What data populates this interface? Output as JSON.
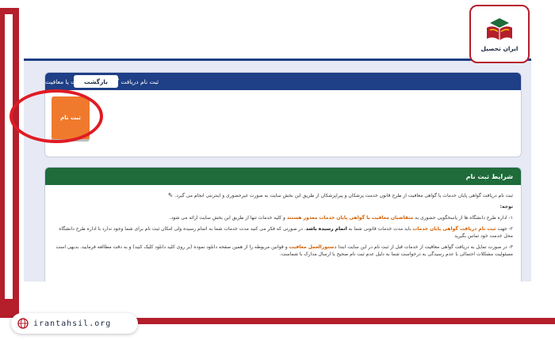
{
  "brand": {
    "logo_text": "ایران تحصیل",
    "site_url": "irantahsil.org",
    "accent_color": "#b51e2b"
  },
  "panel_register": {
    "title": "ثبت نام دریافت گواهی پایان خدمات یا معافیت",
    "back_label": "بازگشت",
    "tile_label": "ثبت نام",
    "header_color": "#1f3f86",
    "tile_color": "#ef7a2d",
    "highlight_color": "#e01b24"
  },
  "panel_conditions": {
    "title": "شرایط ثبت نام",
    "header_color": "#1f6b3a",
    "intro": "ثبت نام دریافت گواهی پایان خدمات یا گواهی معافیت از طرح قانون خدمت پزشکان و پیراپزشکان از طریق این بخش سایت به صورت غیرحضوری و اینترنتی انجام می گیرد.",
    "note_label": "توجه:",
    "item1_prefix": "۱- اداره طرح دانشگاه ها از پاسخگویی حضوری به ",
    "item1_link": "متقاضیان معافیت یا گواهی پایان خدمات معذور هستند",
    "item1_suffix": " و کلیه خدمات تنها از طریق این بخش سایت ارائه می شود.",
    "item2_prefix": "۲- جهت ",
    "item2_link": "ثبت نام دریافت گواهی پایان خدمات",
    "item2_middle": " باید مدت خدمات قانونی شما به ",
    "item2_bold": "اتمام رسیده باشد",
    "item2_suffix": ". در صورتی که فکر می کنید مدت خدمات شما به اتمام رسیده ولی امکان ثبت نام برای شما وجود ندارد با اداره طرح دانشگاه محل خدمت خود تماس بگیرید",
    "item3_prefix": "۳- در صورت تمایل به دریافت گواهی معافیت از خدمات قبل از ثبت نام در این سایت ابتدا ",
    "item3_link": "دستورالعمل معافیت",
    "item3_suffix": " و قوانین مربوطه را از همین صفحه دانلود نموده (بر روی کلید دانلود کلیک کنید) و به دقت مطالعه فرمایید. بدیهی است مسئولیت مشکلات احتمالی با عدم رسیدگی به درخواست شما به دلیل عدم ثبت نام صحیح یا ارسال مدارک با شماست."
  }
}
